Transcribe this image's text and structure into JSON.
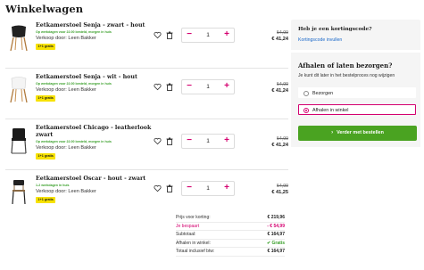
{
  "page": {
    "title": "Winkelwagen"
  },
  "cart": {
    "items": [
      {
        "title": "Eetkamerstoel Senja - zwart - hout",
        "stock": "Op werkdagen voor 22.00 besteld, morgen in huis",
        "seller": "Verkoop door: Leen Bakker",
        "badge": "1+1 gratis",
        "quantity": "1",
        "old_price": "54,99",
        "new_price": "€ 41,24",
        "image_color": "#222222"
      },
      {
        "title": "Eetkamerstoel Senja - wit - hout",
        "stock": "Op werkdagen voor 22.00 besteld, morgen in huis",
        "seller": "Verkoop door: Leen Bakker",
        "badge": "1+1 gratis",
        "quantity": "1",
        "old_price": "54,99",
        "new_price": "€ 41,24",
        "image_color": "#f2f2f2"
      },
      {
        "title": "Eetkamerstoel Chicago - leatherlook zwart",
        "stock": "Op werkdagen voor 22.00 besteld, morgen in huis",
        "seller": "Verkoop door: Leen Bakker",
        "badge": "1+1 gratis",
        "quantity": "1",
        "old_price": "54,99",
        "new_price": "€ 41,24",
        "image_color": "#1a1a1a"
      },
      {
        "title": "Eetkamerstoel Oscar - hout - zwart",
        "stock": "1-2 werkdagen in huis",
        "seller": "Verkoop door: Leen Bakker",
        "badge": "1+1 gratis",
        "quantity": "1",
        "old_price": "54,99",
        "new_price": "€ 41,25",
        "image_color": "#222222"
      }
    ]
  },
  "totals": {
    "rows": [
      {
        "label": "Prijs voor korting:",
        "amount": "€ 219,96"
      },
      {
        "label": "Je bespaart",
        "amount": "- € 54,99"
      },
      {
        "label": "Subtotaal:",
        "amount": "€ 164,97"
      },
      {
        "label": "Afhalen in winkel:",
        "amount": "Gratis"
      },
      {
        "label": "Totaal inclusief btw:",
        "amount": "€ 164,97"
      }
    ]
  },
  "sidebar": {
    "coupon_title": "Heb je een kortingscode?",
    "coupon_link": "Kortingscode invullen",
    "shipping_title": "Afhalen of laten bezorgen?",
    "shipping_desc": "Je kunt dit later in het bestelproces nog wijzigen",
    "options": [
      {
        "label": "Bezorgen",
        "selected": false
      },
      {
        "label": "Afhalen in winkel",
        "selected": true
      }
    ],
    "cta_label": "Verder met bestellen",
    "cta_chevron": "›"
  },
  "colors": {
    "accent": "#d4006f",
    "cta": "#4aa321",
    "badge": "#f7e200",
    "stock": "#3aa02a",
    "link": "#1a68c9"
  },
  "icons": {
    "minus": "−",
    "plus": "+"
  }
}
